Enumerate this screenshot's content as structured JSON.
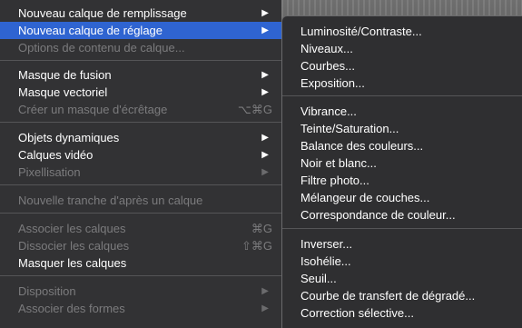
{
  "main_menu": {
    "items": [
      {
        "label": "Nouveau calque de remplissage",
        "has_submenu": true
      },
      {
        "label": "Nouveau calque de réglage",
        "has_submenu": true,
        "highlighted": true
      },
      {
        "label": "Options de contenu de calque...",
        "disabled": true
      },
      {
        "label": "Masque de fusion",
        "has_submenu": true
      },
      {
        "label": "Masque vectoriel",
        "has_submenu": true
      },
      {
        "label": "Créer un masque d'écrêtage",
        "disabled": true,
        "shortcut": "⌥⌘G"
      },
      {
        "label": "Objets dynamiques",
        "has_submenu": true
      },
      {
        "label": "Calques vidéo",
        "has_submenu": true
      },
      {
        "label": "Pixellisation",
        "disabled": true,
        "has_submenu": true
      },
      {
        "label": "Nouvelle tranche d'après un calque",
        "disabled": true
      },
      {
        "label": "Associer les calques",
        "disabled": true,
        "shortcut": "⌘G"
      },
      {
        "label": "Dissocier les calques",
        "disabled": true,
        "shortcut": "⇧⌘G"
      },
      {
        "label": "Masquer les calques"
      },
      {
        "label": "Disposition",
        "disabled": true,
        "has_submenu": true
      },
      {
        "label": "Associer des formes",
        "disabled": true,
        "has_submenu": true
      }
    ],
    "arrow_glyph": "▶"
  },
  "sub_menu": {
    "items": [
      {
        "label": "Luminosité/Contraste..."
      },
      {
        "label": "Niveaux..."
      },
      {
        "label": "Courbes..."
      },
      {
        "label": "Exposition..."
      },
      {
        "label": "Vibrance..."
      },
      {
        "label": "Teinte/Saturation..."
      },
      {
        "label": "Balance des couleurs..."
      },
      {
        "label": "Noir et blanc..."
      },
      {
        "label": "Filtre photo..."
      },
      {
        "label": "Mélangeur de couches..."
      },
      {
        "label": "Correspondance de couleur..."
      },
      {
        "label": "Inverser..."
      },
      {
        "label": "Isohélie..."
      },
      {
        "label": "Seuil..."
      },
      {
        "label": "Courbe de transfert de dégradé..."
      },
      {
        "label": "Correction sélective..."
      }
    ]
  },
  "colors": {
    "menu_bg": "#323234",
    "highlight": "#2f64d1",
    "disabled_text": "#7b7b7d"
  }
}
